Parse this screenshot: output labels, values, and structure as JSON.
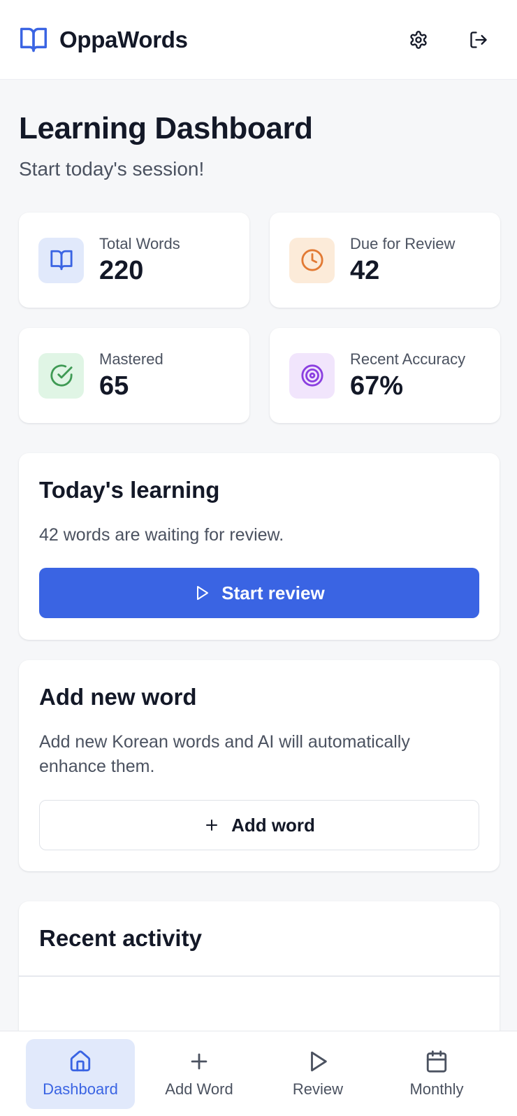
{
  "app": {
    "name": "OppaWords"
  },
  "colors": {
    "accent": "#3a64e3",
    "orange": "#e27a34",
    "green": "#3f9a54",
    "purple": "#8b3fe0"
  },
  "header": {
    "icons": [
      "book-open-icon",
      "gear-icon",
      "logout-icon"
    ]
  },
  "page": {
    "title": "Learning Dashboard",
    "subtitle": "Start today's session!"
  },
  "stats": [
    {
      "label": "Total Words",
      "value": "220",
      "icon": "book-open-icon"
    },
    {
      "label": "Due for Review",
      "value": "42",
      "icon": "clock-icon"
    },
    {
      "label": "Mastered",
      "value": "65",
      "icon": "check-circle-icon"
    },
    {
      "label": "Recent Accuracy",
      "value": "67%",
      "icon": "target-icon"
    }
  ],
  "today": {
    "title": "Today's learning",
    "text": "42 words are waiting for review.",
    "button": "Start review"
  },
  "addword": {
    "title": "Add new word",
    "text": "Add new Korean words and AI will automatically enhance them.",
    "button": "Add word"
  },
  "activity": {
    "title": "Recent activity"
  },
  "nav": [
    {
      "label": "Dashboard",
      "active": true,
      "icon": "home-icon"
    },
    {
      "label": "Add Word",
      "active": false,
      "icon": "plus-icon"
    },
    {
      "label": "Review",
      "active": false,
      "icon": "play-icon"
    },
    {
      "label": "Monthly",
      "active": false,
      "icon": "calendar-icon"
    }
  ]
}
